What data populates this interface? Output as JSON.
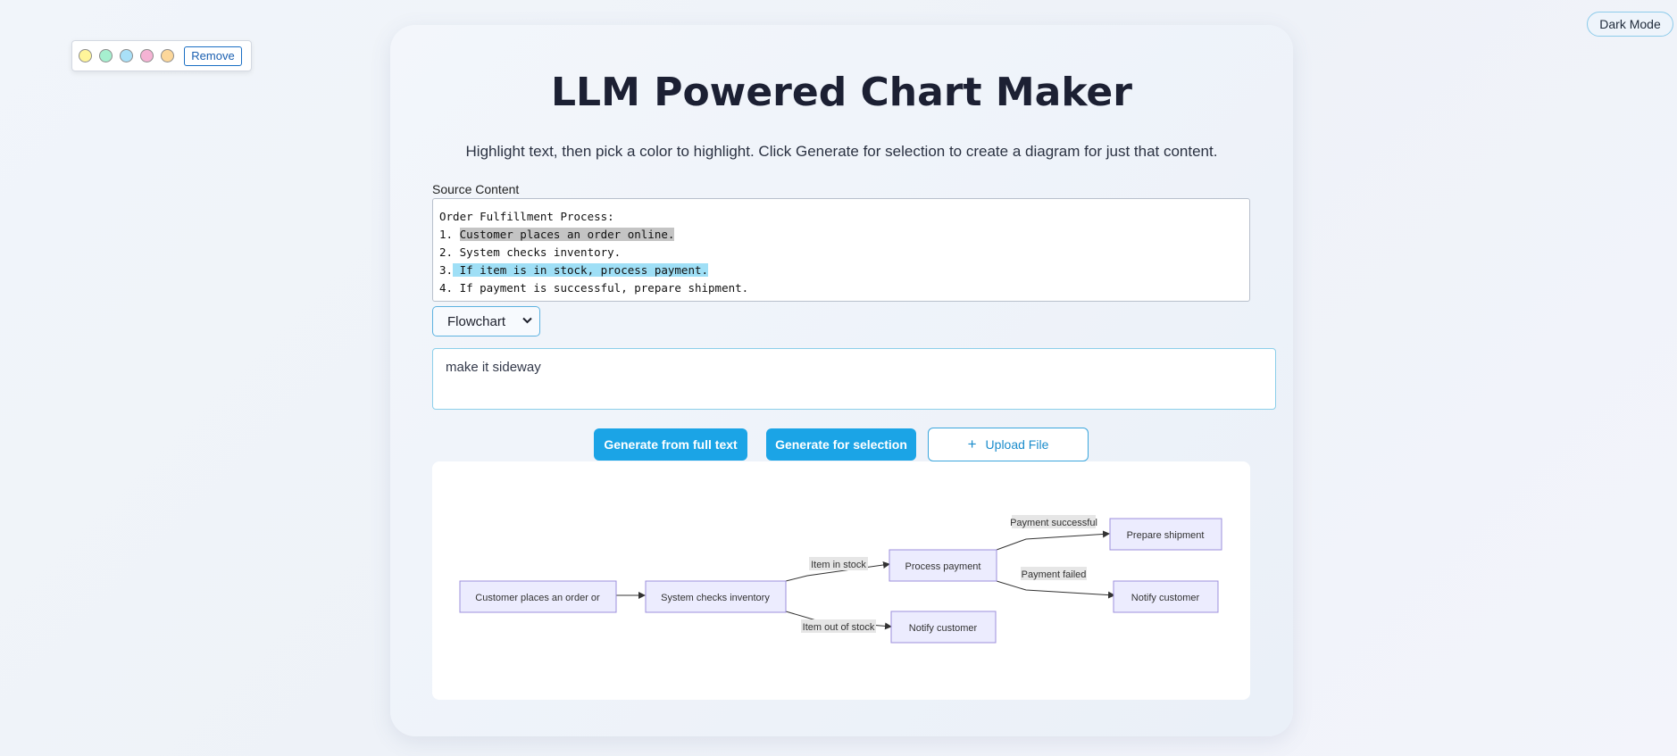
{
  "header": {
    "dark_mode_label": "Dark Mode"
  },
  "palette": {
    "swatches": [
      {
        "name": "yellow",
        "color": "#fff59a"
      },
      {
        "name": "green",
        "color": "#a6f0cf"
      },
      {
        "name": "blue",
        "color": "#a9e0f8"
      },
      {
        "name": "pink",
        "color": "#f5b3d4"
      },
      {
        "name": "orange",
        "color": "#fcd79a"
      }
    ],
    "remove_label": "Remove"
  },
  "main": {
    "title": "LLM Powered Chart Maker",
    "subtitle": "Highlight text, then pick a color to highlight. Click Generate for selection to create a diagram for just that content.",
    "source_label": "Source Content",
    "source_lines": [
      {
        "prefix": "Order Fulfillment Process:",
        "highlight": "",
        "suffix": ""
      },
      {
        "prefix": "1. ",
        "highlight": "Customer places an order online.",
        "suffix": ""
      },
      {
        "prefix": "2. System checks inventory.",
        "highlight": "",
        "suffix": ""
      },
      {
        "prefix": "3.",
        "highlight": " If item is in stock, process payment.",
        "suffix": ""
      },
      {
        "prefix": "4. If payment is successful, prepare shipment.",
        "highlight": "",
        "suffix": ""
      }
    ],
    "chart_type_selected": "Flowchart",
    "prompt_value": "make it sideway",
    "buttons": {
      "generate_full": "Generate from full text",
      "generate_selection": "Generate for selection",
      "upload": "Upload File"
    }
  },
  "diagram": {
    "nodes": {
      "customer": "Customer places an order or",
      "inventory": "System checks inventory",
      "process": "Process payment",
      "notify_stock": "Notify customer",
      "prepare": "Prepare shipment",
      "notify_payment": "Notify customer"
    },
    "edges": {
      "in_stock": "Item in stock",
      "out_of_stock": "Item out of stock",
      "pay_ok": "Payment successful",
      "pay_fail": "Payment failed"
    },
    "colors": {
      "node_fill": "#ececfe",
      "node_stroke": "#9d8fdc",
      "label_bg": "#e6e6e6"
    }
  },
  "colors": {
    "accent": "#1ba4e6",
    "highlight_gray": "#c4c4c4",
    "highlight_blue": "#9fdff6"
  }
}
